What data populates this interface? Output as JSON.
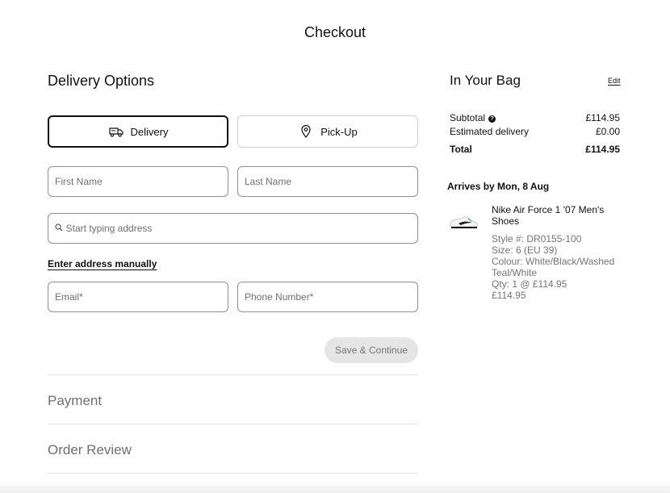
{
  "page_title": "Checkout",
  "delivery": {
    "heading": "Delivery Options",
    "options": [
      {
        "label": "Delivery",
        "icon": "truck-icon",
        "selected": true
      },
      {
        "label": "Pick-Up",
        "icon": "location-pin-icon",
        "selected": false
      }
    ],
    "fields": {
      "first_name": {
        "placeholder": "First Name",
        "value": ""
      },
      "last_name": {
        "placeholder": "Last Name",
        "value": ""
      },
      "address": {
        "placeholder": "Start typing address",
        "value": "",
        "icon": "search-icon"
      },
      "email": {
        "placeholder": "Email*",
        "value": ""
      },
      "phone": {
        "placeholder": "Phone Number*",
        "value": ""
      }
    },
    "manual_link": "Enter address manually",
    "save_button": "Save & Continue"
  },
  "sections": {
    "payment": "Payment",
    "order_review": "Order Review"
  },
  "bag": {
    "heading": "In Your Bag",
    "edit_label": "Edit",
    "subtotal_label": "Subtotal",
    "subtotal_value": "£114.95",
    "delivery_label": "Estimated delivery",
    "delivery_value": "£0.00",
    "total_label": "Total",
    "total_value": "£114.95",
    "arrives": "Arrives by Mon, 8 Aug",
    "product": {
      "name": "Nike Air Force 1 '07 Men's Shoes",
      "style": "Style #: DR0155-100",
      "size": "Size: 6 (EU 39)",
      "colour": "Colour: White/Black/Washed Teal/White",
      "qty": "Qty: 1 @ £114.95",
      "price": "£114.95",
      "image_icon": "sneaker-image"
    }
  },
  "colors": {
    "text": "#111111",
    "muted": "#757575",
    "border": "#8f8f8f",
    "disabled_bg": "#e5e5e5"
  }
}
